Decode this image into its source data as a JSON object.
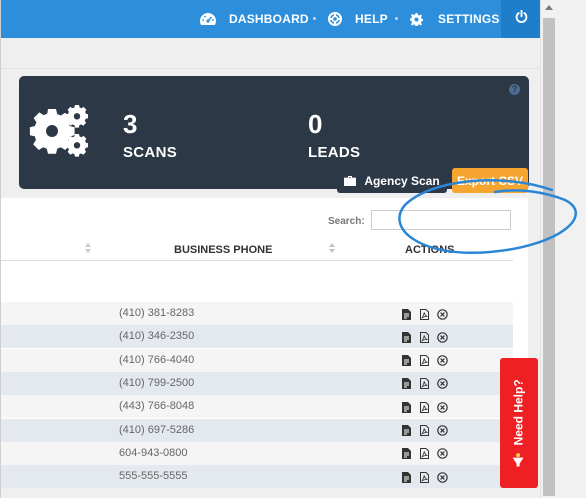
{
  "nav": {
    "dashboard": "DASHBOARD",
    "help": "HELP",
    "settings": "SETTINGS"
  },
  "stats": {
    "scans": {
      "value": "3",
      "label": "SCANS"
    },
    "leads": {
      "value": "0",
      "label": "LEADS"
    }
  },
  "buttons": {
    "agency_scan": "Agency Scan",
    "export_csv": "Export CSV"
  },
  "search": {
    "label": "Search:",
    "value": ""
  },
  "table": {
    "headers": [
      "BUSINESS PHONE",
      "ACTIONS"
    ],
    "rows": [
      {
        "phone": "(410) 381-8283"
      },
      {
        "phone": "(410) 346-2350"
      },
      {
        "phone": "(410) 766-4040"
      },
      {
        "phone": "(410) 799-2500"
      },
      {
        "phone": "(443) 766-8048"
      },
      {
        "phone": "(410) 697-5286"
      },
      {
        "phone": "604-943-0800"
      },
      {
        "phone": "555-555-5555"
      }
    ]
  },
  "help_tab": {
    "label": "Need Help?"
  },
  "colors": {
    "topbar": "#2d8fdb",
    "stats_panel": "#2c3846",
    "export_button": "#f7a531",
    "help_tab": "#ee2024",
    "callout": "#2b86d6"
  }
}
